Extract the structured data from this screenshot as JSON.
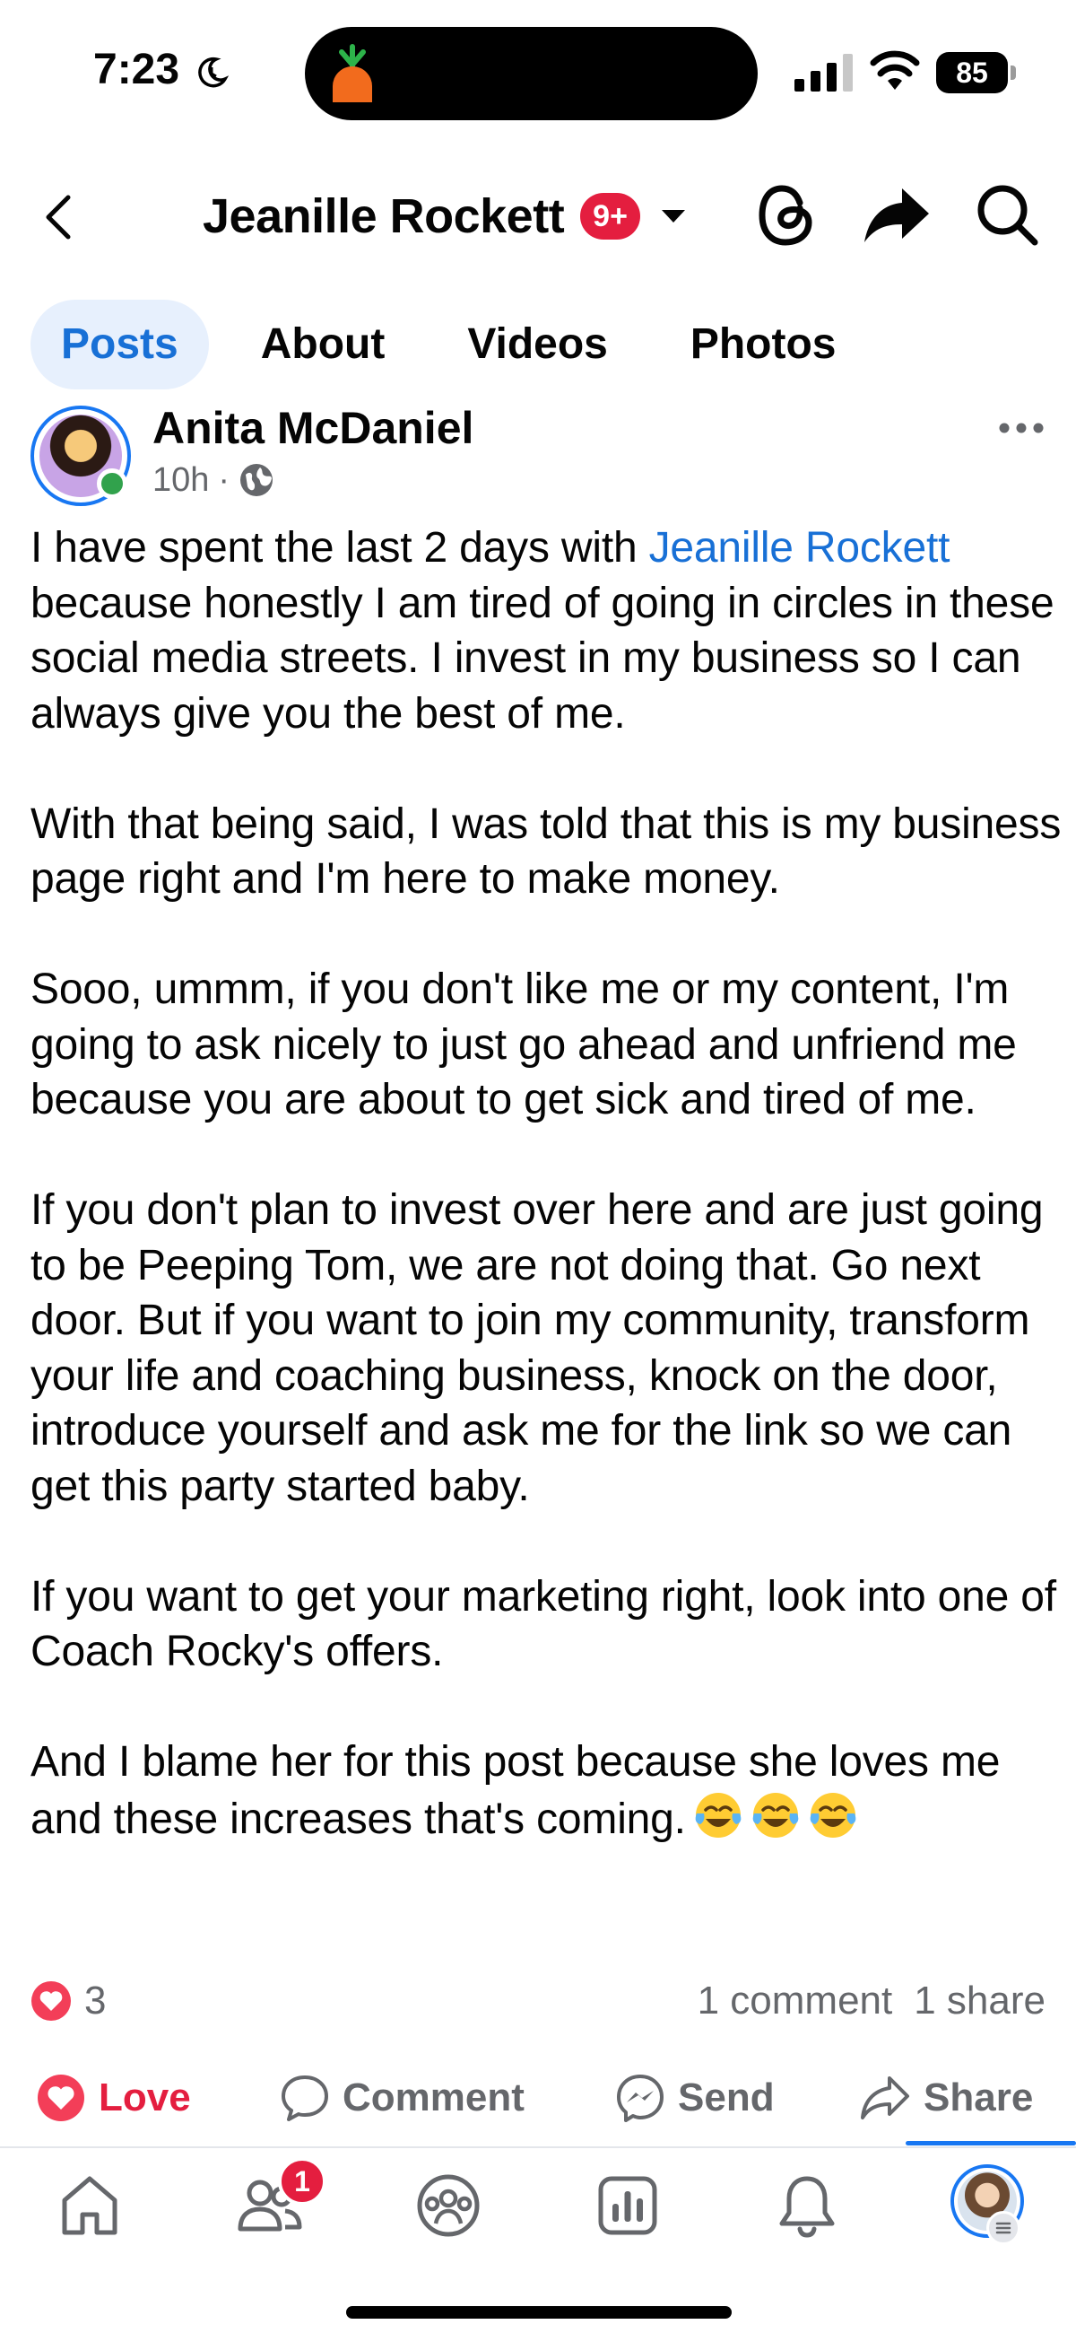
{
  "status_bar": {
    "time": "7:23",
    "battery": "85",
    "icons": [
      "moon-clock-icon",
      "carrot-app-icon",
      "signal-icon",
      "wifi-icon",
      "battery-icon"
    ]
  },
  "header": {
    "title": "Jeanille Rockett",
    "badge": "9+",
    "icons": [
      "back-icon",
      "dropdown-caret-icon",
      "threads-icon",
      "share-arrow-icon",
      "search-icon"
    ]
  },
  "tabs": [
    {
      "label": "Posts",
      "active": true
    },
    {
      "label": "About",
      "active": false
    },
    {
      "label": "Videos",
      "active": false
    },
    {
      "label": "Photos",
      "active": false
    }
  ],
  "post": {
    "author": "Anita McDaniel",
    "time": "10h",
    "separator": "·",
    "audience_icon": "globe-icon",
    "paragraphs": {
      "p1_before": "I have spent the last 2 days with ",
      "p1_mention": "Jeanille Rockett",
      "p1_after": " because honestly I am tired of going in circles in these social media streets. I invest in my business so I can always give you the best of me.",
      "p2": "With that being said, I was told that this is my business page right and I'm here to make money.",
      "p3": "Sooo, ummm, if you don't like me or my content, I'm going to ask nicely to just go ahead and unfriend me because you are about to get sick and tired of me.",
      "p4": "If you don't plan to invest over here and are just going to be Peeping Tom, we are not doing that. Go next door. But if you want to join my community, transform your life and coaching business, knock on the door, introduce yourself and ask me for the link so we can get this party started baby.",
      "p5": "If you want to get your marketing right, look into one of Coach Rocky's offers.",
      "p6": "And I blame her for this post because she loves me and these increases that's coming."
    },
    "emojis": [
      "tears-of-joy-icon",
      "tears-of-joy-icon",
      "tears-of-joy-icon"
    ],
    "reaction_count": "3",
    "comments": "1 comment",
    "shares": "1 share"
  },
  "actions": {
    "love": "Love",
    "comment": "Comment",
    "send": "Send",
    "share": "Share"
  },
  "bottom_nav": {
    "items": [
      "home-icon",
      "friends-icon",
      "groups-icon",
      "dashboard-icon",
      "notifications-icon",
      "profile-avatar"
    ],
    "friends_badge": "1"
  },
  "colors": {
    "accent": "#1877f2",
    "mention": "#1870d6",
    "love": "#e41e3f",
    "secondary_text": "#65676b",
    "active_tab_bg": "#e7f0fd"
  }
}
